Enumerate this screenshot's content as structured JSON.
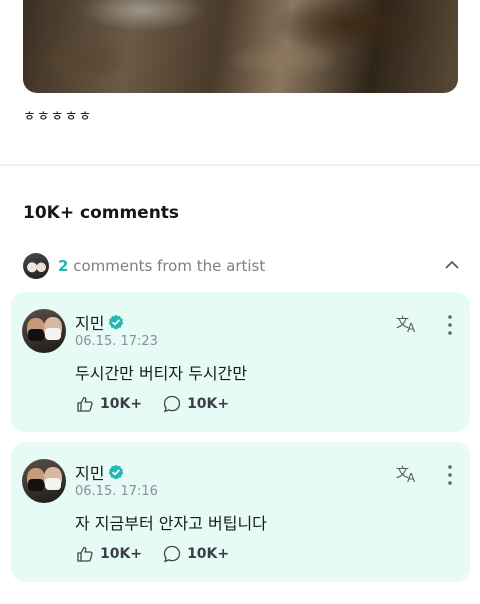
{
  "post": {
    "caption": "ㅎㅎㅎㅎㅎ"
  },
  "comments_section": {
    "title": "10K+ comments",
    "artist_comments": {
      "count": "2",
      "label": "comments from the artist"
    }
  },
  "comments": [
    {
      "author": "지민",
      "timestamp": "06.15. 17:23",
      "text": "두시간만 버티자 두시간만",
      "likes": "10K+",
      "replies": "10K+"
    },
    {
      "author": "지민",
      "timestamp": "06.15. 17:16",
      "text": "자 지금부터 안자고 버팁니다",
      "likes": "10K+",
      "replies": "10K+"
    }
  ],
  "colors": {
    "accent": "#22b8b1",
    "card_background": "#e6fbf6",
    "verified": "#26b7b0"
  },
  "icons": {
    "verified": "verified-badge-icon",
    "translate": "translate-icon",
    "more": "more-vertical-icon",
    "like": "like-icon",
    "reply": "reply-bubble-icon",
    "collapse": "chevron-up-icon"
  }
}
